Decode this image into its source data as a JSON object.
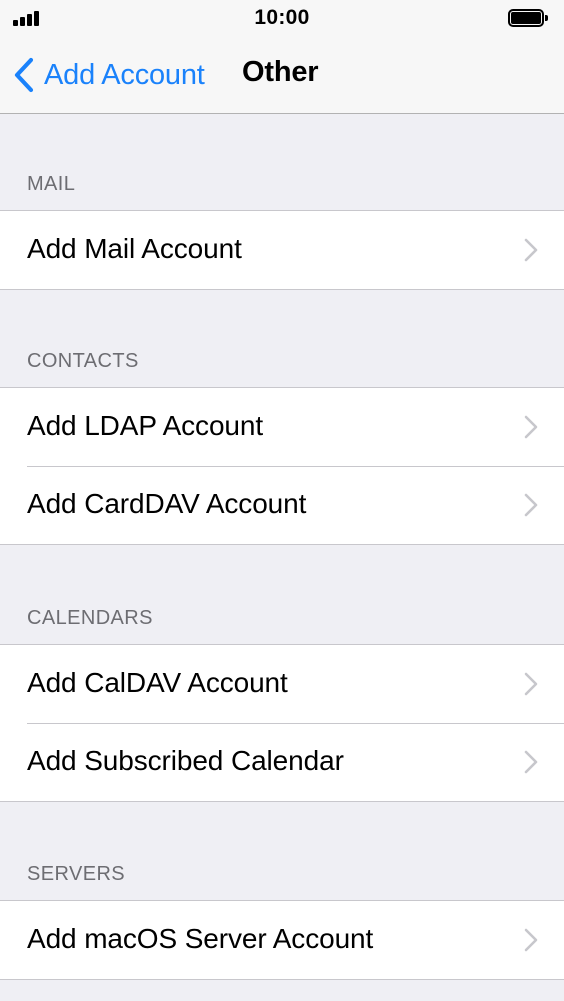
{
  "status_bar": {
    "time": "10:00"
  },
  "nav": {
    "back_label": "Add Account",
    "title": "Other"
  },
  "colors": {
    "accent": "#1a82fb",
    "background": "#efeff4",
    "section_header": "#6d6d72",
    "separator": "#c8c7cc",
    "chevron": "#c7c7cc"
  },
  "sections": [
    {
      "header": "MAIL",
      "items": [
        {
          "label": "Add Mail Account"
        }
      ]
    },
    {
      "header": "CONTACTS",
      "items": [
        {
          "label": "Add LDAP Account"
        },
        {
          "label": "Add CardDAV Account"
        }
      ]
    },
    {
      "header": "CALENDARS",
      "items": [
        {
          "label": "Add CalDAV Account"
        },
        {
          "label": "Add Subscribed Calendar"
        }
      ]
    },
    {
      "header": "SERVERS",
      "items": [
        {
          "label": "Add macOS Server Account"
        }
      ]
    }
  ],
  "icons": {
    "back": "chevron-left-icon",
    "disclosure": "chevron-right-icon",
    "signal": "cellular-signal-icon",
    "battery": "battery-icon"
  }
}
